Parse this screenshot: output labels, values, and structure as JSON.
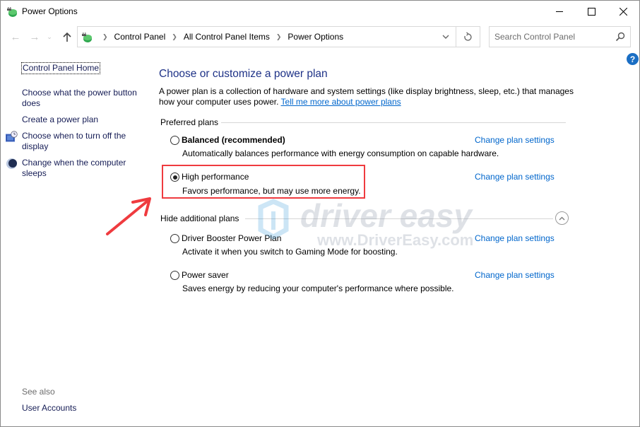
{
  "window": {
    "title": "Power Options",
    "controls": {
      "minimize": "minimize",
      "maximize": "maximize",
      "close": "close"
    }
  },
  "address_bar": {
    "breadcrumbs": [
      "Control Panel",
      "All Control Panel Items",
      "Power Options"
    ],
    "search_placeholder": "Search Control Panel"
  },
  "left_pane": {
    "home_link": "Control Panel Home",
    "links": [
      {
        "label": "Choose what the power button does",
        "icon": null
      },
      {
        "label": "Create a power plan",
        "icon": null
      },
      {
        "label": "Choose when to turn off the display",
        "icon": "display-clock-icon"
      },
      {
        "label": "Change when the computer sleeps",
        "icon": "moon-sleep-icon"
      }
    ],
    "see_also_label": "See also",
    "see_also_links": [
      "User Accounts"
    ]
  },
  "main": {
    "title": "Choose or customize a power plan",
    "intro_text": "A power plan is a collection of hardware and system settings (like display brightness, sleep, etc.) that manages how your computer uses power. ",
    "intro_link": "Tell me more about power plans",
    "preferred_header": "Preferred plans",
    "additional_header": "Hide additional plans",
    "change_link_label": "Change plan settings",
    "preferred_plans": [
      {
        "name": "Balanced (recommended)",
        "description": "Automatically balances performance with energy consumption on capable hardware.",
        "selected": false,
        "bold": true
      },
      {
        "name": "High performance",
        "description": "Favors performance, but may use more energy.",
        "selected": true,
        "bold": false
      }
    ],
    "additional_plans": [
      {
        "name": "Driver Booster Power Plan",
        "description": "Activate it when you switch to Gaming Mode for boosting.",
        "selected": false
      },
      {
        "name": "Power saver",
        "description": "Saves energy by reducing your computer's performance where possible.",
        "selected": false
      }
    ]
  },
  "annotations": {
    "highlight_color": "#ef3b3f",
    "watermark_brand": "driver easy",
    "watermark_url": "www.DriverEasy.com"
  },
  "colors": {
    "heading": "#1e3287",
    "link": "#0066cc",
    "nav_link": "#151c55"
  }
}
